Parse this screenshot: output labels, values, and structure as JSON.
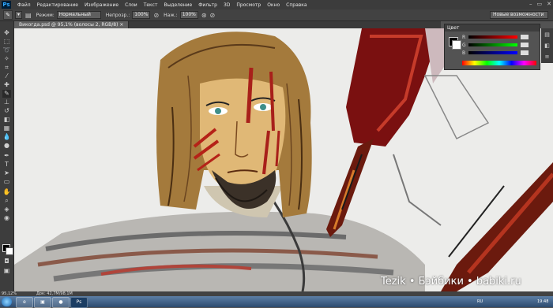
{
  "app": {
    "logo": "Ps",
    "menu": [
      "Файл",
      "Редактирование",
      "Изображение",
      "Слои",
      "Текст",
      "Выделение",
      "Фильтр",
      "3D",
      "Просмотр",
      "Окно",
      "Справка"
    ],
    "window_controls": [
      "–",
      "▭",
      "✕"
    ]
  },
  "options": {
    "mode_label": "Режим:",
    "mode_value": "Нормальный",
    "opacity_label": "Непрозр.:",
    "opacity_value": "100%",
    "flow_label": "Наж.:",
    "flow_value": "100%",
    "workspace": "Новые возможности"
  },
  "document": {
    "tab_title": "Викогда.psd @ 95,1% (волосы 2, RGB/8) ×"
  },
  "panel": {
    "title": "Цвет",
    "labels": [
      "R",
      "G",
      "B"
    ]
  },
  "status": {
    "zoom": "95,12%",
    "doc": "Док: 42,7M/98,1M"
  },
  "taskbar": {
    "apps": [
      "e",
      "▣",
      "●",
      "Ps"
    ],
    "lang": "RU",
    "time": "19:48"
  },
  "watermark": "Tezik • Бэйбики • babiki.ru",
  "colors": {
    "hair": "#a47a3c",
    "blood": "#a8201a",
    "weapon": "#7a1010",
    "skin": "#e0b876"
  }
}
